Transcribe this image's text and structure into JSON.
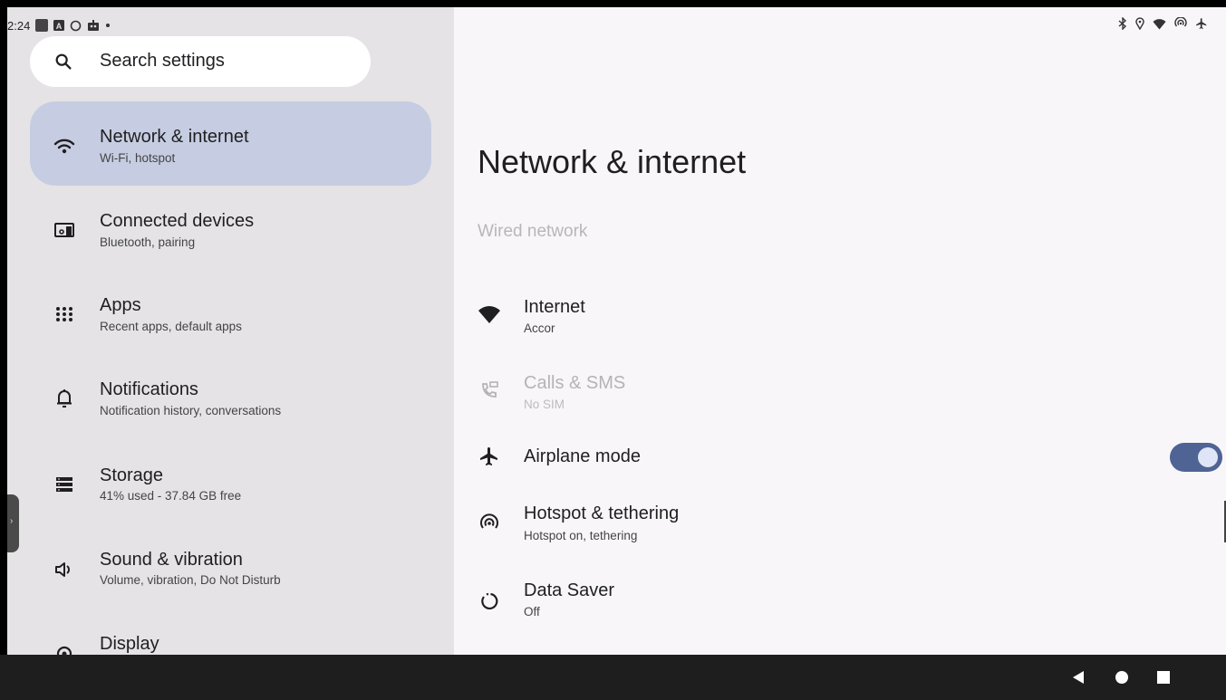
{
  "status_bar": {
    "time": "2:24",
    "left_icons": [
      "app-square-icon",
      "a-badge-icon",
      "sync-circle-icon",
      "robot-icon",
      "dot-icon"
    ],
    "right_icons": [
      "bluetooth-icon",
      "location-icon",
      "wifi-icon",
      "hotspot-icon",
      "airplane-icon"
    ]
  },
  "search": {
    "placeholder": "Search settings"
  },
  "sidebar": {
    "items": [
      {
        "title": "Network & internet",
        "subtitle": "Wi-Fi, hotspot",
        "icon": "wifi-icon",
        "selected": true
      },
      {
        "title": "Connected devices",
        "subtitle": "Bluetooth, pairing",
        "icon": "devices-icon"
      },
      {
        "title": "Apps",
        "subtitle": "Recent apps, default apps",
        "icon": "apps-grid-icon"
      },
      {
        "title": "Notifications",
        "subtitle": "Notification history, conversations",
        "icon": "bell-icon"
      },
      {
        "title": "Storage",
        "subtitle": "41% used - 37.84 GB free",
        "icon": "storage-icon"
      },
      {
        "title": "Sound & vibration",
        "subtitle": "Volume, vibration, Do Not Disturb",
        "icon": "speaker-icon"
      },
      {
        "title": "Display",
        "subtitle": "",
        "icon": "display-gear-icon"
      }
    ]
  },
  "main": {
    "title": "Network & internet",
    "section_label": "Wired network",
    "items": [
      {
        "title": "Internet",
        "subtitle": "Accor",
        "icon": "wifi-filled-icon",
        "enabled": true
      },
      {
        "title": "Calls & SMS",
        "subtitle": "No SIM",
        "icon": "calls-sms-icon",
        "enabled": false
      },
      {
        "title": "Airplane mode",
        "subtitle": "",
        "icon": "airplane-icon",
        "toggle": true,
        "checked": true
      },
      {
        "title": "Hotspot & tethering",
        "subtitle": "Hotspot on, tethering",
        "icon": "hotspot-icon",
        "enabled": true
      },
      {
        "title": "Data Saver",
        "subtitle": "Off",
        "icon": "data-saver-icon",
        "enabled": true
      }
    ]
  },
  "nav": {
    "buttons": [
      "back-icon",
      "home-icon",
      "recents-icon"
    ]
  },
  "colors": {
    "sidebar_bg": "#e5e3e6",
    "selected_bg": "#c6cde2",
    "content_bg": "#f8f6f9",
    "toggle_on": "#4f6394",
    "nav_bg": "#1e1e1e"
  }
}
